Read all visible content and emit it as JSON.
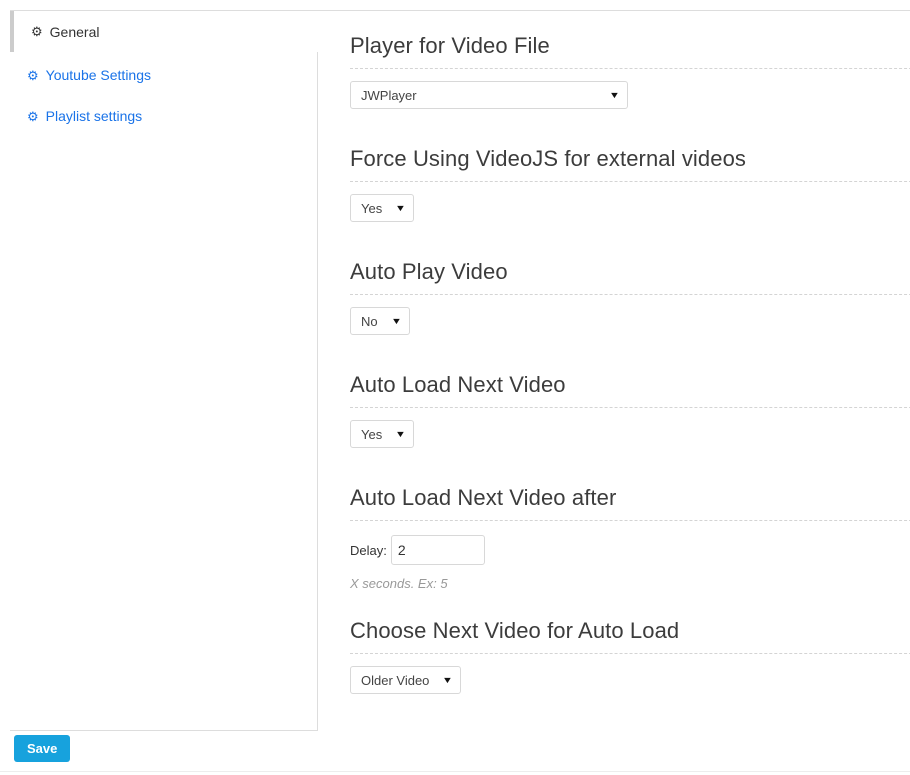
{
  "sidebar": {
    "active_tab": {
      "label": "General",
      "icon": "gear-icon",
      "icon_glyph": "⚙"
    },
    "items": [
      {
        "label": "Youtube Settings",
        "icon": "gear-icon",
        "icon_glyph": "⚙"
      },
      {
        "label": "Playlist settings",
        "icon": "gear-icon",
        "icon_glyph": "⚙"
      }
    ]
  },
  "sections": [
    {
      "title": "Player for Video File",
      "control": "select",
      "value": "JWPlayer",
      "caret": "▼"
    },
    {
      "title": "Force Using VideoJS for external videos",
      "control": "select",
      "value": "Yes",
      "caret": "▼"
    },
    {
      "title": "Auto Play Video",
      "control": "select",
      "value": "No",
      "caret": "▼"
    },
    {
      "title": "Auto Load Next Video",
      "control": "select",
      "value": "Yes",
      "caret": "▼"
    },
    {
      "title": "Auto Load Next Video after",
      "control": "text",
      "field_label": "Delay:",
      "value": "2",
      "help": "X seconds. Ex: 5"
    },
    {
      "title": "Choose Next Video for Auto Load",
      "control": "select",
      "value": "Older Video",
      "caret": "▼"
    }
  ],
  "footer": {
    "save_label": "Save"
  },
  "colors": {
    "link_blue": "#1a73e8",
    "save_blue": "#17a2dd",
    "heading": "#3c3c3c",
    "border": "#dddddd",
    "help_text": "#999999"
  }
}
